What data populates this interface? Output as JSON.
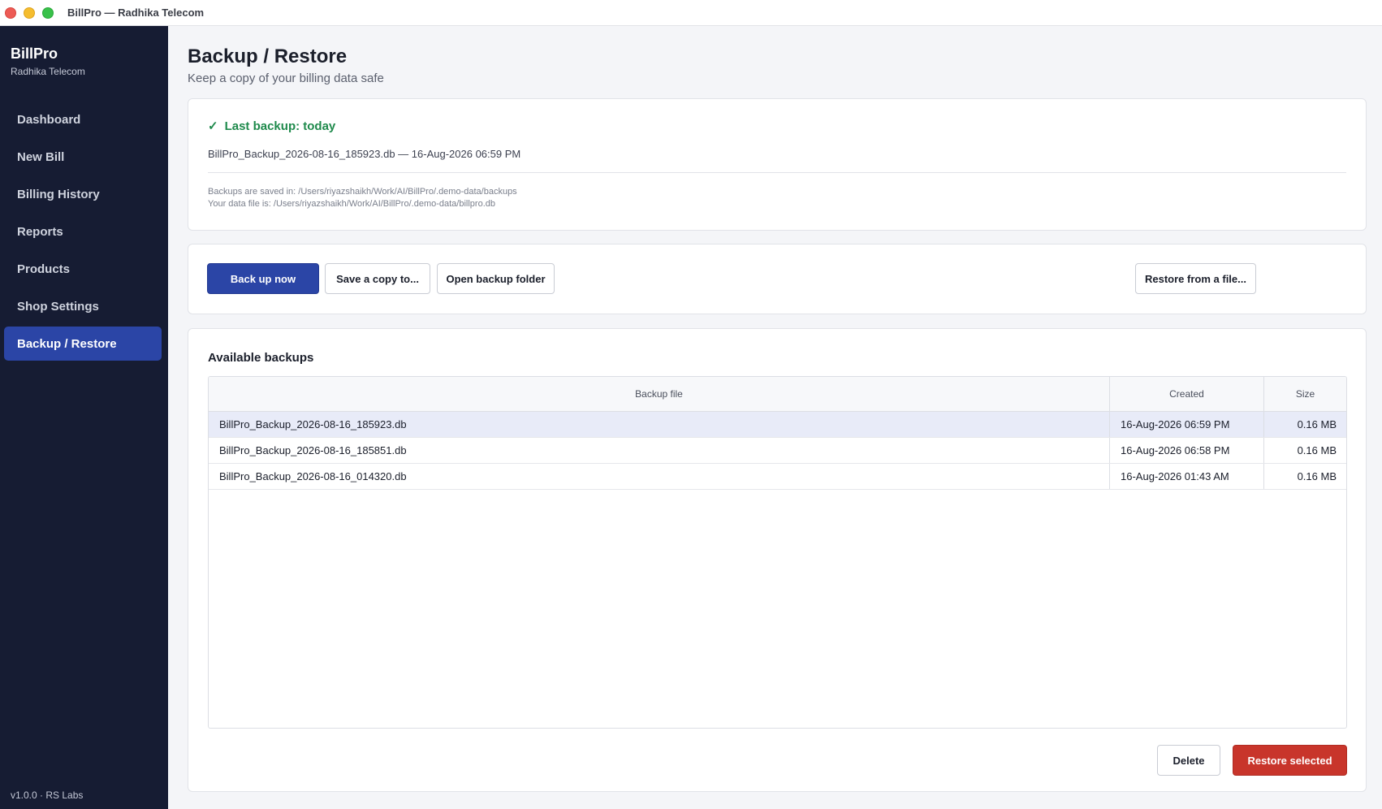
{
  "window": {
    "title": "BillPro — Radhika Telecom"
  },
  "sidebar": {
    "brand": "BillPro",
    "shop": "Radhika Telecom",
    "items": [
      {
        "label": "Dashboard"
      },
      {
        "label": "New Bill"
      },
      {
        "label": "Billing History"
      },
      {
        "label": "Reports"
      },
      {
        "label": "Products"
      },
      {
        "label": "Shop Settings"
      },
      {
        "label": "Backup / Restore",
        "active": true
      }
    ],
    "version": "v1.0.0 · RS Labs"
  },
  "header": {
    "title": "Backup / Restore",
    "subtitle": "Keep a copy of your billing data safe"
  },
  "status": {
    "check_icon": "✓",
    "last_backup": "Last backup: today",
    "last_file": "BillPro_Backup_2026-08-16_185923.db — 16-Aug-2026 06:59 PM",
    "backup_path": "Backups are saved in:  /Users/riyazshaikh/Work/AI/BillPro/.demo-data/backups",
    "data_path": "Your data file is:  /Users/riyazshaikh/Work/AI/BillPro/.demo-data/billpro.db",
    "color": "#1f8a4c"
  },
  "actions": {
    "backup_now": "Back up now",
    "save_copy": "Save a copy to...",
    "open_folder": "Open backup folder",
    "restore_file": "Restore from a file..."
  },
  "backups": {
    "title": "Available backups",
    "columns": [
      "Backup file",
      "Created",
      "Size"
    ],
    "rows": [
      {
        "file": "BillPro_Backup_2026-08-16_185923.db",
        "created": "16-Aug-2026 06:59 PM",
        "size": "0.16 MB",
        "selected": true
      },
      {
        "file": "BillPro_Backup_2026-08-16_185851.db",
        "created": "16-Aug-2026 06:58 PM",
        "size": "0.16 MB"
      },
      {
        "file": "BillPro_Backup_2026-08-16_014320.db",
        "created": "16-Aug-2026 01:43 AM",
        "size": "0.16 MB"
      }
    ],
    "delete": "Delete",
    "restore_selected": "Restore selected"
  },
  "colors": {
    "sidebar_bg": "#161c33",
    "accent": "#2b45a6",
    "danger": "#c8352b",
    "success": "#1f8a4c"
  }
}
